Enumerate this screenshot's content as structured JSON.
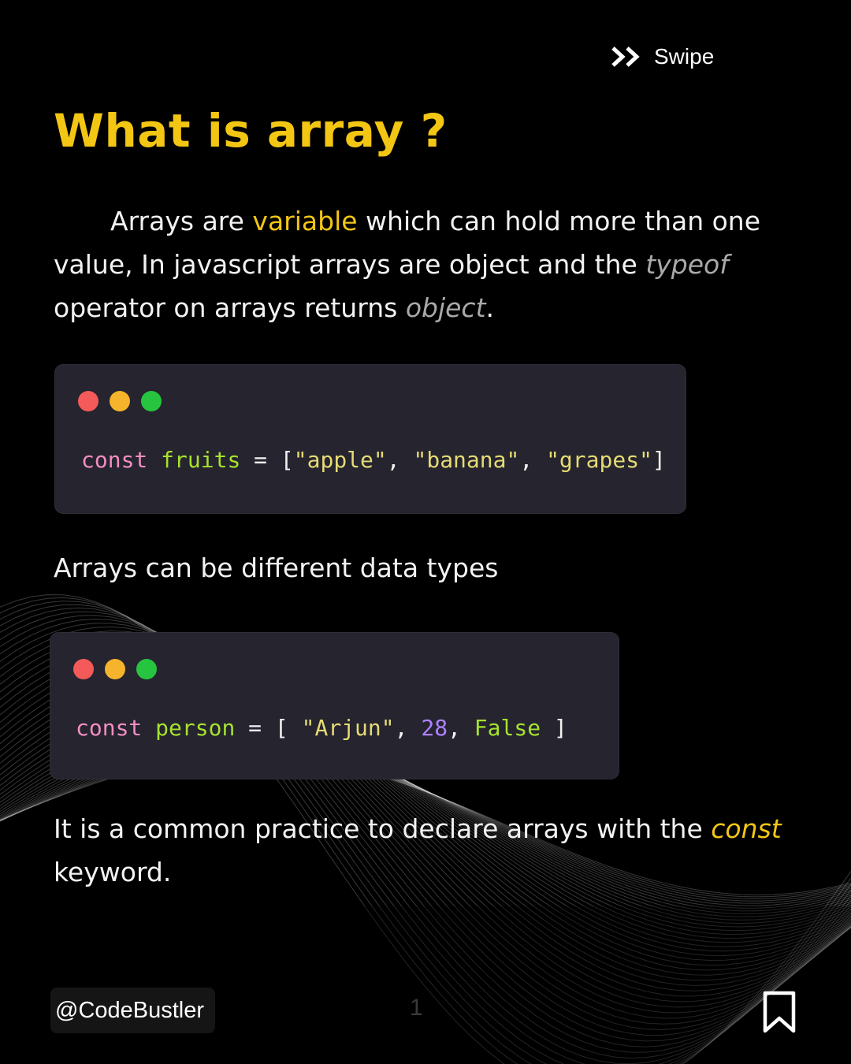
{
  "header": {
    "swipe_label": "Swipe",
    "swipe_icon": "double-chevron-right-icon"
  },
  "title": "What is array ?",
  "intro": {
    "part1": "Arrays are ",
    "highlight_variable": "variable",
    "part2": " which can hold more than one value, In javascript arrays are object and the ",
    "highlight_typeof": "typeof",
    "part3": " operator on arrays returns ",
    "highlight_object": "object",
    "part4": "."
  },
  "code1": {
    "keyword": "const",
    "name": "fruits",
    "op": "=",
    "open": "[",
    "items": [
      "\"apple\"",
      "\"banana\"",
      "\"grapes\""
    ],
    "sep": ", ",
    "close": "]"
  },
  "subtext": "Arrays can be different data types",
  "code2": {
    "keyword": "const",
    "name": "person",
    "op": "=",
    "open": "[ ",
    "item_string": "\"Arjun\"",
    "item_number": "28",
    "item_bool": "False",
    "sep": ", ",
    "close": " ]"
  },
  "note": {
    "part1": "It is a common practice to declare arrays with the ",
    "highlight_const": "const",
    "part2": " keyword."
  },
  "footer": {
    "handle": "@CodeBustler",
    "page_number": "1",
    "bookmark_icon": "bookmark-icon"
  },
  "colors": {
    "background": "#000000",
    "accent_yellow": "#f3c614",
    "code_bg": "#25242f",
    "keyword_pink": "#f28ec2",
    "identifier_green": "#a6e22e",
    "string_yellow": "#e6db74",
    "number_purple": "#ae81ff"
  }
}
